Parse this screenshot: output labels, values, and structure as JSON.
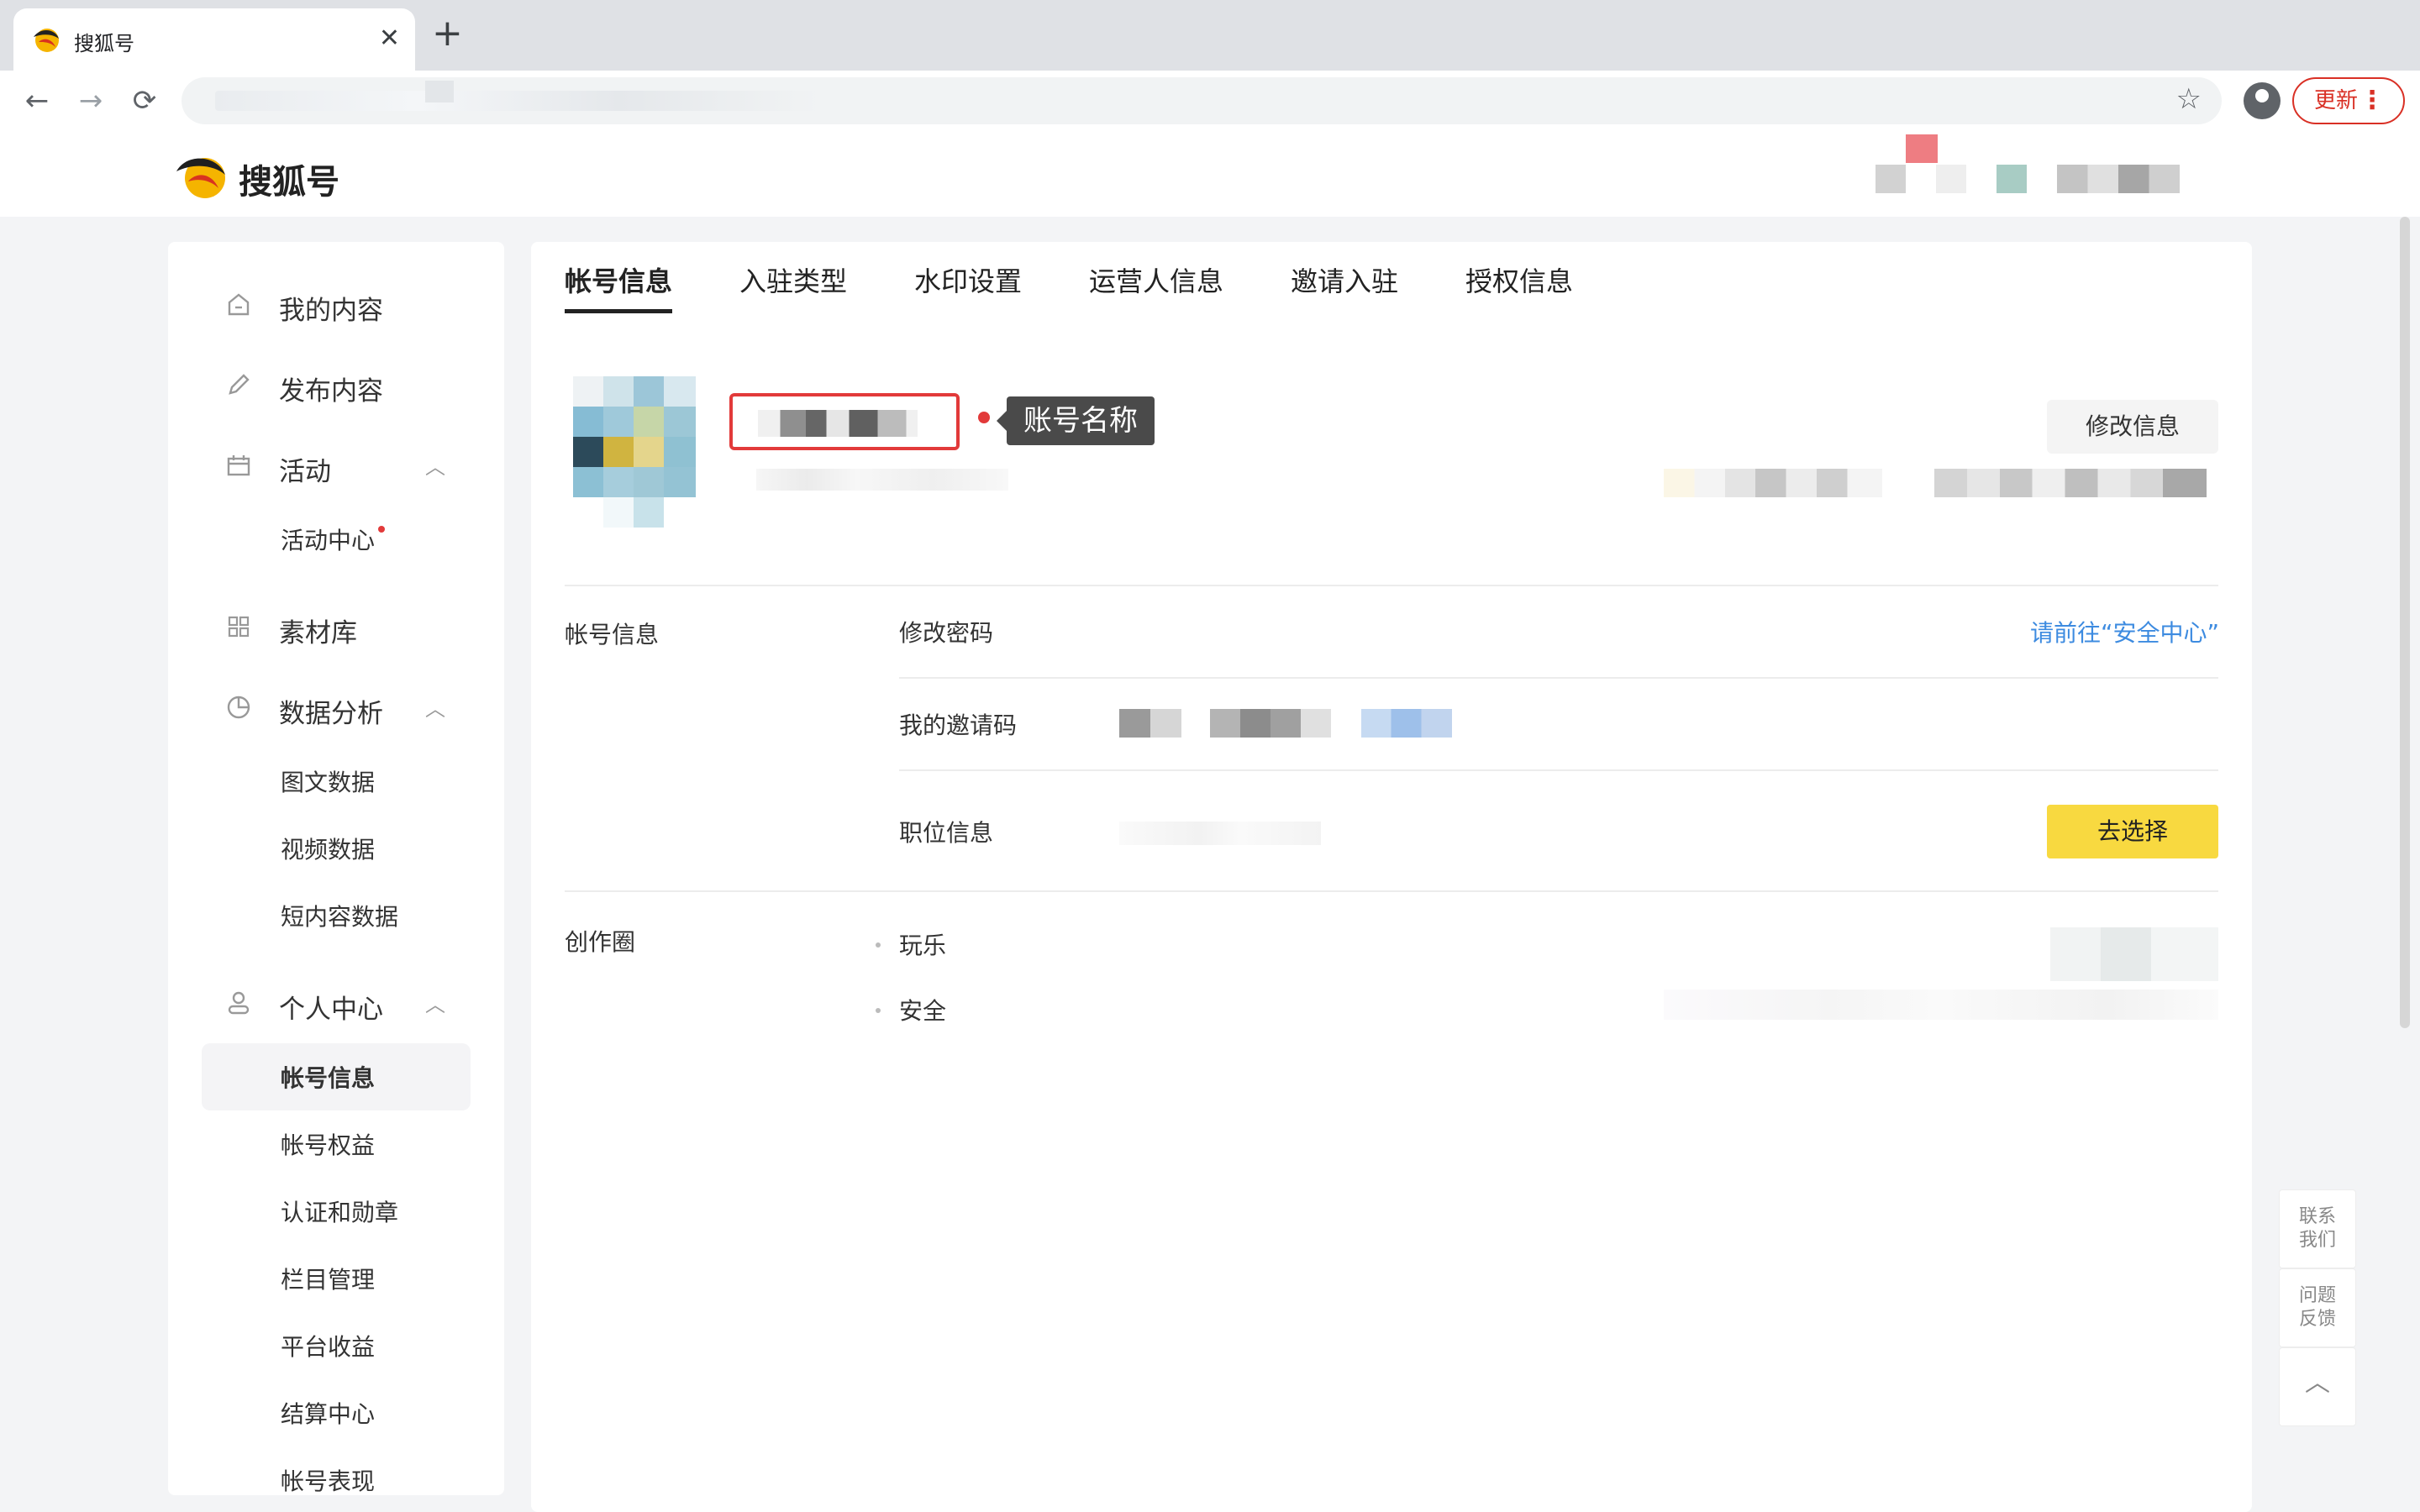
{
  "browser": {
    "tab_title": "搜狐号",
    "tab_close": "✕",
    "new_tab": "+",
    "back": "←",
    "forward": "→",
    "reload": "⟳",
    "bookmark": "☆",
    "update_label": "更新",
    "menu": "⋮"
  },
  "site": {
    "logo_text": "搜狐号"
  },
  "sidebar": {
    "items": [
      {
        "label": "我的内容",
        "icon": "home-icon"
      },
      {
        "label": "发布内容",
        "icon": "pen-icon"
      },
      {
        "label": "活动",
        "icon": "calendar-icon",
        "expanded": true
      },
      {
        "label": "素材库",
        "icon": "grid-icon"
      },
      {
        "label": "数据分析",
        "icon": "pie-chart-icon",
        "expanded": true
      },
      {
        "label": "个人中心",
        "icon": "user-icon",
        "expanded": true
      }
    ],
    "subitems": {
      "activity": [
        "活动中心"
      ],
      "data": [
        "图文数据",
        "视频数据",
        "短内容数据"
      ],
      "personal": [
        "帐号信息",
        "帐号权益",
        "认证和勋章",
        "栏目管理",
        "平台收益",
        "结算中心",
        "帐号表现"
      ]
    },
    "active_subitem": "帐号信息",
    "caret": "︿"
  },
  "main": {
    "tabs": [
      "帐号信息",
      "入驻类型",
      "水印设置",
      "运营人信息",
      "邀请入驻",
      "授权信息"
    ],
    "active_tab": "帐号信息",
    "callout": "账号名称",
    "edit_button": "修改信息",
    "account_section": "帐号信息",
    "rows": {
      "password": "修改密码",
      "password_link": "请前往“安全中心”",
      "invite": "我的邀请码",
      "position": "职位信息",
      "position_button": "去选择"
    },
    "creation_section": "创作圈",
    "circles": [
      "玩乐",
      "安全"
    ]
  },
  "float": {
    "contact": "联系\n我们",
    "feedback": "问题\n反馈",
    "top": "︿"
  },
  "colors": {
    "accent_red": "#e23a3a",
    "link_blue": "#3d8be0",
    "button_yellow": "#f8d940"
  }
}
